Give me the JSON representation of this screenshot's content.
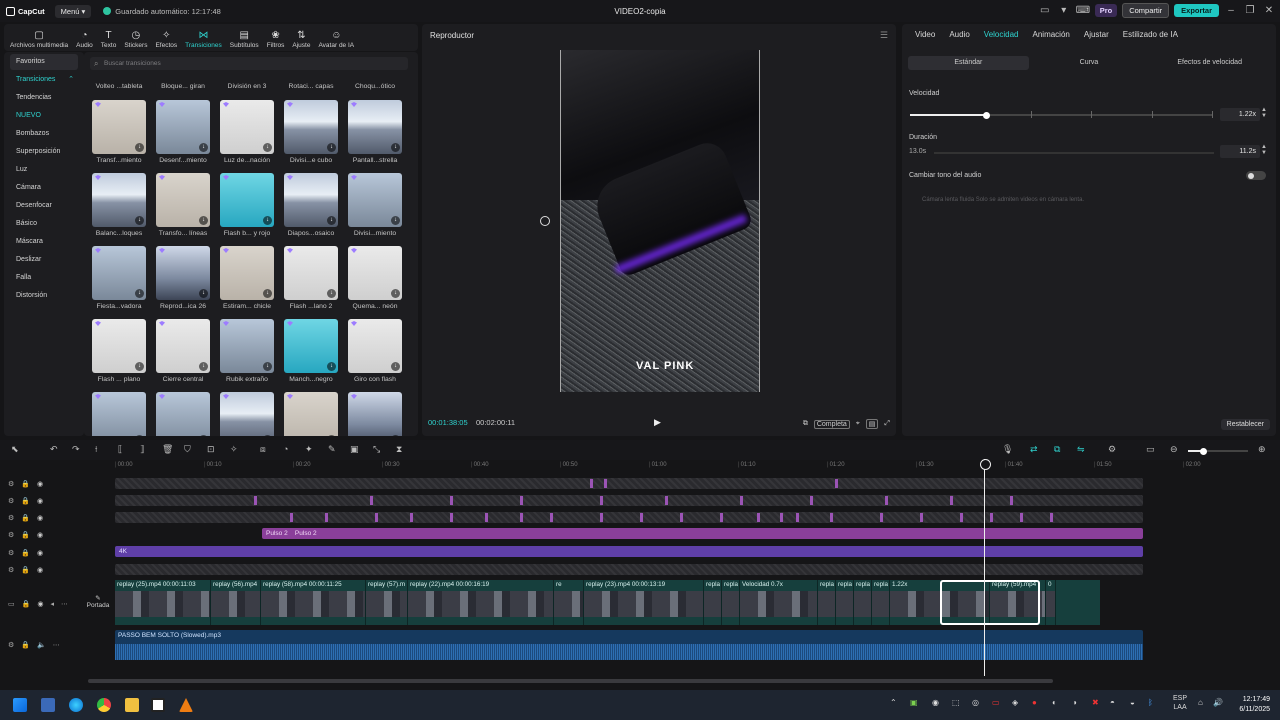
{
  "window": {
    "app_name": "CapCut",
    "menu_label": "Menú",
    "autosave": "Guardado automático: 12:17:48",
    "project_title": "VIDEO2-copia",
    "pro_label": "Pro",
    "share_label": "Compartir",
    "export_label": "Exportar"
  },
  "toolbar": [
    {
      "label": "Archivos multimedia",
      "icon": "media-icon"
    },
    {
      "label": "Audio",
      "icon": "audio-icon"
    },
    {
      "label": "Texto",
      "icon": "text-icon"
    },
    {
      "label": "Stickers",
      "icon": "sticker-icon"
    },
    {
      "label": "Efectos",
      "icon": "effects-icon"
    },
    {
      "label": "Transiciones",
      "icon": "transition-icon",
      "active": true
    },
    {
      "label": "Subtítulos",
      "icon": "subtitles-icon"
    },
    {
      "label": "Filtros",
      "icon": "filter-icon"
    },
    {
      "label": "Ajuste",
      "icon": "adjust-icon"
    },
    {
      "label": "Avatar de IA",
      "icon": "avatar-icon"
    }
  ],
  "categories": [
    "Favoritos",
    "Transiciones",
    "Tendencias",
    "NUEVO",
    "Bombazos",
    "Superposición",
    "Luz",
    "Cámara",
    "Desenfocar",
    "Básico",
    "Máscara",
    "Deslizar",
    "Falla",
    "Distorsión"
  ],
  "search_placeholder": "Buscar transiciones",
  "transitions": {
    "top_row_labels": [
      "Volteo ...tableta",
      "Bloque... giran",
      "División en 3",
      "Rotaci... capas",
      "Choqu...ótico"
    ],
    "rows": [
      [
        {
          "label": "Transf...miento",
          "thumb": "girl"
        },
        {
          "label": "Desenf...miento",
          "thumb": "city"
        },
        {
          "label": "Luz de...nación",
          "thumb": "guy"
        },
        {
          "label": "Divisi...e cubo",
          "thumb": "mtn"
        },
        {
          "label": "Pantall...strella",
          "thumb": "mtn"
        }
      ],
      [
        {
          "label": "Balanc...loques",
          "thumb": "mtn"
        },
        {
          "label": "Transfo... líneas",
          "thumb": "girl"
        },
        {
          "label": "Flash b... y rojo",
          "thumb": "cyan"
        },
        {
          "label": "Diapos...osaico",
          "thumb": "mtn"
        },
        {
          "label": "Divisi...miento",
          "thumb": "city"
        }
      ],
      [
        {
          "label": "Fiesta...vadora",
          "thumb": "city"
        },
        {
          "label": "Reprod...ica 26",
          "thumb": "sky"
        },
        {
          "label": "Estiram... chicle",
          "thumb": "girl"
        },
        {
          "label": "Flash ...lano 2",
          "thumb": "guy"
        },
        {
          "label": "Quema... neón",
          "thumb": "guy"
        }
      ],
      [
        {
          "label": "Flash ... plano",
          "thumb": "guy"
        },
        {
          "label": "Cierre central",
          "thumb": "guy"
        },
        {
          "label": "Rubik extraño",
          "thumb": "city"
        },
        {
          "label": "Manch...negro",
          "thumb": "cyan"
        },
        {
          "label": "Giro con flash",
          "thumb": "guy"
        }
      ],
      [
        {
          "label": "",
          "thumb": "city"
        },
        {
          "label": "",
          "thumb": "city"
        },
        {
          "label": "",
          "thumb": "mtn"
        },
        {
          "label": "",
          "thumb": "girl"
        },
        {
          "label": "",
          "thumb": "sky"
        }
      ]
    ]
  },
  "player": {
    "title": "Reproductor",
    "current_time": "00:01:38:05",
    "total_time": "00:02:00:11",
    "watermark": "VAL PINK",
    "full_label": "Completa"
  },
  "properties": {
    "tabs": [
      "Video",
      "Audio",
      "Velocidad",
      "Animación",
      "Ajustar",
      "Estilizado de IA"
    ],
    "active_tab": "Velocidad",
    "modes": [
      "Estándar",
      "Curva",
      "Efectos de velocidad"
    ],
    "speed_label": "Velocidad",
    "speed_value": "1.22x",
    "speed_fraction": 0.25,
    "duration_label": "Duración",
    "duration_from": "13.0s",
    "duration_to": "11.2s",
    "pitch_label": "Cambiar tono del audio",
    "note": "Cámara lenta fluida   Solo se admiten videos en cámara lenta.",
    "reset_label": "Restablecer"
  },
  "ruler": [
    "00:00",
    "00:10",
    "00:20",
    "00:30",
    "00:40",
    "00:50",
    "01:00",
    "01:10",
    "01:20",
    "01:30",
    "01:40",
    "01:50",
    "02:00"
  ],
  "timeline": {
    "pulse_labels": [
      "Pulso 2",
      "Pulso 2"
    ],
    "fx_label": "4K",
    "cover_label": "Portada",
    "clips": [
      {
        "label": "replay (25).mp4  00:00:11:03",
        "w": 96
      },
      {
        "label": "replay (56).mp4",
        "w": 50
      },
      {
        "label": "replay (58).mp4  00:00:11:25",
        "w": 105
      },
      {
        "label": "replay (57).m",
        "w": 42
      },
      {
        "label": "replay (22).mp4  00:00:16:19",
        "w": 146
      },
      {
        "label": "re",
        "w": 30
      },
      {
        "label": "replay (23).mp4  00:00:13:19",
        "w": 120
      },
      {
        "label": "repla",
        "w": 18
      },
      {
        "label": "repla",
        "w": 18
      },
      {
        "label": "Velocidad 0.7x",
        "w": 78
      },
      {
        "label": "repla",
        "w": 18
      },
      {
        "label": "repla",
        "w": 18
      },
      {
        "label": "repla",
        "w": 18
      },
      {
        "label": "repla",
        "w": 18
      },
      {
        "label": "1.22x",
        "w": 100
      },
      {
        "label": "replay (59).mp4",
        "w": 56
      },
      {
        "label": "0",
        "w": 10
      }
    ],
    "audio_label": "PASSO BEM SOLTO (Slowed).mp3"
  },
  "taskbar": {
    "lang": "ESP",
    "lang2": "LAA",
    "time": "12:17:49",
    "date": "6/11/2025"
  }
}
